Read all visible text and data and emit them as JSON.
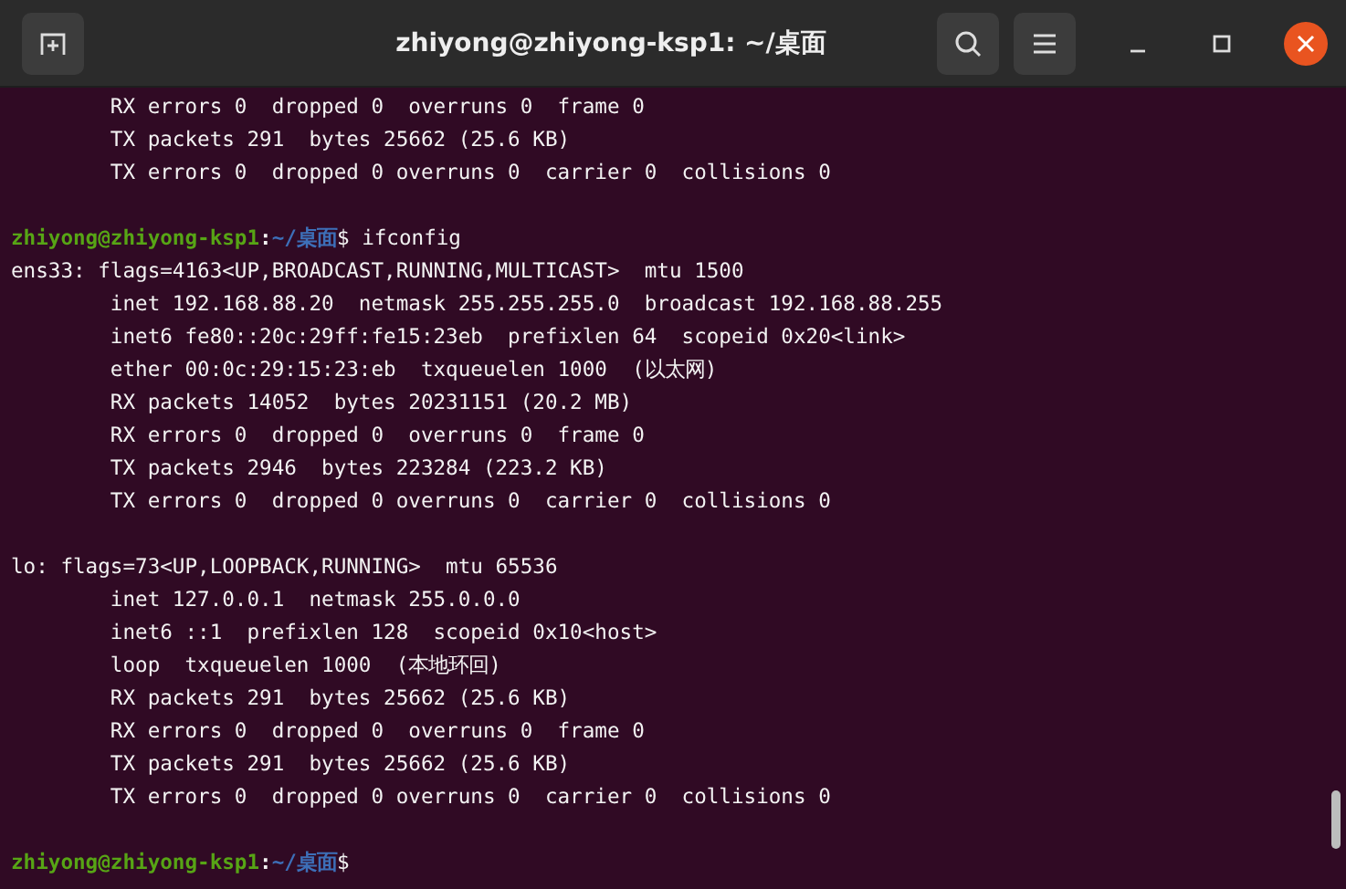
{
  "window": {
    "title": "zhiyong@zhiyong-ksp1: ~/桌面"
  },
  "terminal": {
    "lines": [
      {
        "kind": "output",
        "text": "        RX errors 0  dropped 0  overruns 0  frame 0"
      },
      {
        "kind": "output",
        "text": "        TX packets 291  bytes 25662 (25.6 KB)"
      },
      {
        "kind": "output",
        "text": "        TX errors 0  dropped 0 overruns 0  carrier 0  collisions 0"
      },
      {
        "kind": "blank"
      },
      {
        "kind": "prompt",
        "user": "zhiyong@zhiyong-ksp1",
        "separator": ":",
        "path": "~/桌面",
        "symbol": "$",
        "command": "ifconfig"
      },
      {
        "kind": "output",
        "text": "ens33: flags=4163<UP,BROADCAST,RUNNING,MULTICAST>  mtu 1500"
      },
      {
        "kind": "output",
        "text": "        inet 192.168.88.20  netmask 255.255.255.0  broadcast 192.168.88.255"
      },
      {
        "kind": "output",
        "text": "        inet6 fe80::20c:29ff:fe15:23eb  prefixlen 64  scopeid 0x20<link>"
      },
      {
        "kind": "output",
        "text": "        ether 00:0c:29:15:23:eb  txqueuelen 1000  (以太网)"
      },
      {
        "kind": "output",
        "text": "        RX packets 14052  bytes 20231151 (20.2 MB)"
      },
      {
        "kind": "output",
        "text": "        RX errors 0  dropped 0  overruns 0  frame 0"
      },
      {
        "kind": "output",
        "text": "        TX packets 2946  bytes 223284 (223.2 KB)"
      },
      {
        "kind": "output",
        "text": "        TX errors 0  dropped 0 overruns 0  carrier 0  collisions 0"
      },
      {
        "kind": "blank"
      },
      {
        "kind": "output",
        "text": "lo: flags=73<UP,LOOPBACK,RUNNING>  mtu 65536"
      },
      {
        "kind": "output",
        "text": "        inet 127.0.0.1  netmask 255.0.0.0"
      },
      {
        "kind": "output",
        "text": "        inet6 ::1  prefixlen 128  scopeid 0x10<host>"
      },
      {
        "kind": "output",
        "text": "        loop  txqueuelen 1000  (本地环回)"
      },
      {
        "kind": "output",
        "text": "        RX packets 291  bytes 25662 (25.6 KB)"
      },
      {
        "kind": "output",
        "text": "        RX errors 0  dropped 0  overruns 0  frame 0"
      },
      {
        "kind": "output",
        "text": "        TX packets 291  bytes 25662 (25.6 KB)"
      },
      {
        "kind": "output",
        "text": "        TX errors 0  dropped 0 overruns 0  carrier 0  collisions 0"
      },
      {
        "kind": "blank"
      },
      {
        "kind": "prompt",
        "user": "zhiyong@zhiyong-ksp1",
        "separator": ":",
        "path": "~/桌面",
        "symbol": "$"
      }
    ]
  }
}
